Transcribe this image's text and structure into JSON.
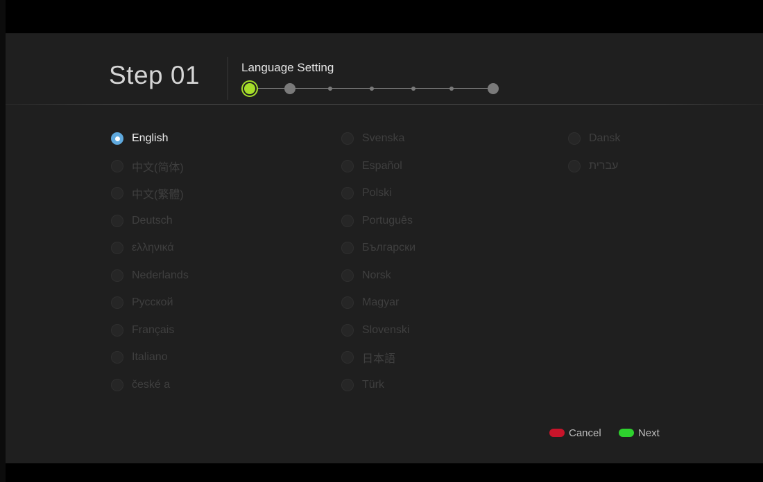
{
  "header": {
    "step_label": "Step 01",
    "title": "Language Setting",
    "progress": {
      "total_steps": 7,
      "current_step": 1
    }
  },
  "languages": {
    "selected": "English",
    "columns": [
      [
        "English",
        "中文(简体)",
        "中文(繁體)",
        "Deutsch",
        "ελληνικά",
        "Nederlands",
        "Русской",
        "Français",
        "Italiano",
        "české a"
      ],
      [
        "Svenska",
        "Español",
        "Polski",
        "Português",
        "Български",
        "Norsk",
        "Magyar",
        "Slovenski",
        "日本語",
        "Türk"
      ],
      [
        "Dansk",
        "עברית"
      ]
    ]
  },
  "footer": {
    "cancel_label": "Cancel",
    "next_label": "Next",
    "cancel_color": "#c8142a",
    "next_color": "#2ed12e"
  },
  "colors": {
    "accent_active_step": "#a6dd2a",
    "radio_selected": "#5fa9de"
  }
}
